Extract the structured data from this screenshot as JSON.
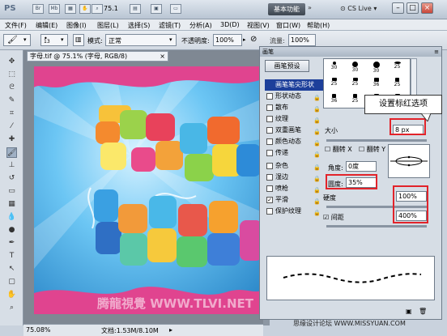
{
  "app": {
    "logo": "PS"
  },
  "titlebar": {
    "icons": [
      "Br",
      "Mb"
    ],
    "zoom": "75.1",
    "workspace_button": "基本功能",
    "cs_live": "CS Live"
  },
  "menubar": {
    "items": [
      "文件(F)",
      "编辑(E)",
      "图像(I)",
      "图层(L)",
      "选择(S)",
      "滤镜(T)",
      "分析(A)",
      "3D(D)",
      "视图(V)",
      "窗口(W)",
      "帮助(H)"
    ]
  },
  "options_bar": {
    "brush_size": "13",
    "mode_label": "模式:",
    "mode_value": "正常",
    "opacity_label": "不透明度:",
    "opacity_value": "100%",
    "flow_label": "流量:",
    "flow_value": "100%"
  },
  "document": {
    "tab_title": "字母.tif @ 75.1% (字母, RGB/8)",
    "zoom_status": "75.08%",
    "doc_status": "文档:1.53M/8.10M"
  },
  "brush_panel": {
    "title": "画笔",
    "preset_button": "画笔预设",
    "options": [
      {
        "label": "画笔笔尖形状",
        "checked": false,
        "selected": true,
        "lock": false
      },
      {
        "label": "形状动态",
        "checked": false,
        "selected": false,
        "lock": true
      },
      {
        "label": "散布",
        "checked": false,
        "selected": false,
        "lock": true
      },
      {
        "label": "纹理",
        "checked": false,
        "selected": false,
        "lock": true
      },
      {
        "label": "双重画笔",
        "checked": false,
        "selected": false,
        "lock": true
      },
      {
        "label": "颜色动态",
        "checked": false,
        "selected": false,
        "lock": true
      },
      {
        "label": "传递",
        "checked": false,
        "selected": false,
        "lock": true
      },
      {
        "label": "杂色",
        "checked": false,
        "selected": false,
        "lock": true
      },
      {
        "label": "湿边",
        "checked": false,
        "selected": false,
        "lock": true
      },
      {
        "label": "喷枪",
        "checked": false,
        "selected": false,
        "lock": true
      },
      {
        "label": "平滑",
        "checked": true,
        "selected": false,
        "lock": true
      },
      {
        "label": "保护纹理",
        "checked": false,
        "selected": false,
        "lock": true
      }
    ],
    "tip_sizes": [
      "30",
      "30",
      "30",
      "25",
      "25",
      "25",
      "36",
      "25",
      "36",
      "25",
      "36",
      "36",
      "32",
      "25",
      "14",
      "24"
    ],
    "size_label": "大小",
    "size_value": "8 px",
    "flip_x": "翻转 X",
    "flip_y": "翻转 Y",
    "angle_label": "角度:",
    "angle_value": "0度",
    "roundness_label": "圆度:",
    "roundness_value": "35%",
    "hardness_label": "硬度",
    "hardness_value": "100%",
    "spacing_label": "间距",
    "spacing_checked": true,
    "spacing_value": "400%"
  },
  "callout": {
    "text": "设置标红选项"
  },
  "watermarks": {
    "canvas": "腾龍視覺 WWW.TLVI.NET",
    "corner": "思缘设计论坛 WWW.MISSYUAN.COM"
  },
  "colors": {
    "highlight_red": "#e2232a",
    "selected_row": "#1d3f9a"
  }
}
